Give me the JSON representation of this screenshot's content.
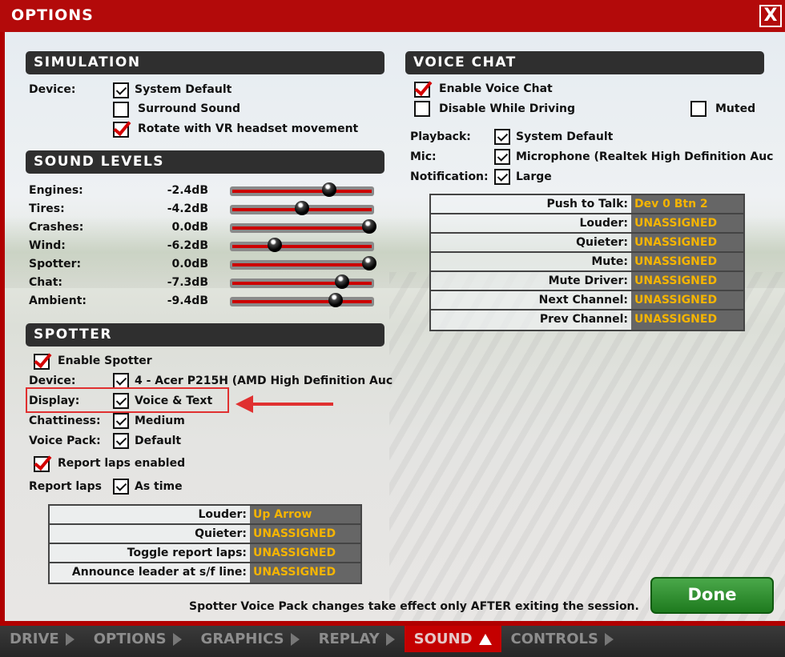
{
  "window": {
    "title": "OPTIONS",
    "close": "X"
  },
  "simulation": {
    "header": "SIMULATION",
    "device_label": "Device:",
    "options": [
      {
        "label": "System Default",
        "checked": true
      },
      {
        "label": "Surround Sound",
        "checked": false
      },
      {
        "label": "Rotate with VR headset movement",
        "checked": true
      }
    ]
  },
  "sound_levels": {
    "header": "SOUND LEVELS",
    "items": [
      {
        "label": "Engines:",
        "value": "-2.4dB",
        "level": 0.7
      },
      {
        "label": "Tires:",
        "value": "-4.2dB",
        "level": 0.5
      },
      {
        "label": "Crashes:",
        "value": "0.0dB",
        "level": 1.0
      },
      {
        "label": "Wind:",
        "value": "-6.2dB",
        "level": 0.3
      },
      {
        "label": "Spotter:",
        "value": "0.0dB",
        "level": 1.0
      },
      {
        "label": "Chat:",
        "value": "-7.3dB",
        "level": 0.8
      },
      {
        "label": "Ambient:",
        "value": "-9.4dB",
        "level": 0.75
      }
    ]
  },
  "spotter": {
    "header": "SPOTTER",
    "enable": "Enable Spotter",
    "device_label": "Device:",
    "device": "4 - Acer P215H (AMD High Definition Auc",
    "display_label": "Display:",
    "display": "Voice & Text",
    "chattiness_label": "Chattiness:",
    "chattiness": "Medium",
    "voicepack_label": "Voice Pack:",
    "voicepack": "Default",
    "report_laps_enabled": "Report laps enabled",
    "report_laps_label": "Report laps",
    "report_laps": "As time",
    "binds": [
      {
        "key": "Louder:",
        "value": "Up Arrow"
      },
      {
        "key": "Quieter:",
        "value": "UNASSIGNED"
      },
      {
        "key": "Toggle report laps:",
        "value": "UNASSIGNED"
      },
      {
        "key": "Announce leader at s/f line:",
        "value": "UNASSIGNED"
      }
    ]
  },
  "voice_chat": {
    "header": "VOICE CHAT",
    "enable": "Enable Voice Chat",
    "disable_driving": "Disable While Driving",
    "muted": "Muted",
    "playback_label": "Playback:",
    "playback": "System Default",
    "mic_label": "Mic:",
    "mic": "Microphone (Realtek High Definition Auc",
    "notification_label": "Notification:",
    "notification": "Large",
    "binds": [
      {
        "key": "Push to Talk:",
        "value": "Dev 0 Btn 2"
      },
      {
        "key": "Louder:",
        "value": "UNASSIGNED"
      },
      {
        "key": "Quieter:",
        "value": "UNASSIGNED"
      },
      {
        "key": "Mute:",
        "value": "UNASSIGNED"
      },
      {
        "key": "Mute Driver:",
        "value": "UNASSIGNED"
      },
      {
        "key": "Next Channel:",
        "value": "UNASSIGNED"
      },
      {
        "key": "Prev Channel:",
        "value": "UNASSIGNED"
      }
    ]
  },
  "note": "Spotter Voice Pack changes take effect only AFTER exiting the session.",
  "done": "Done",
  "nav": [
    {
      "label": "DRIVE"
    },
    {
      "label": "OPTIONS"
    },
    {
      "label": "GRAPHICS"
    },
    {
      "label": "REPLAY"
    },
    {
      "label": "SOUND",
      "active": true
    },
    {
      "label": "CONTROLS"
    }
  ],
  "colors": {
    "frame": "#b30a0a",
    "accent": "#cc0000",
    "bind_value": "#f5b400",
    "done": "#2a8a2a",
    "highlight": "#e03030"
  }
}
